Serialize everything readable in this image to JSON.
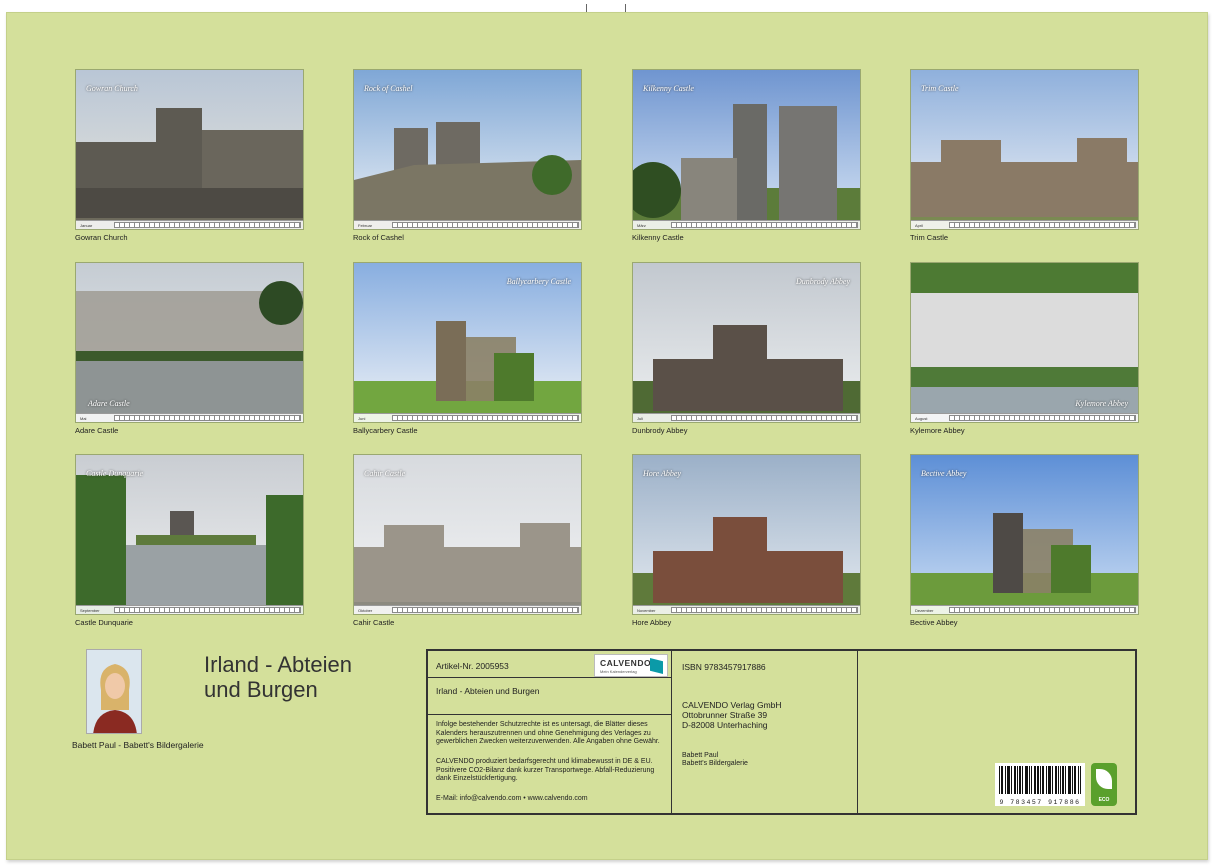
{
  "calendar": {
    "title": "Irland - Abteien und Burgen",
    "title_line1": "Irland - Abteien",
    "title_line2": "und Burgen",
    "author": "Babett Paul - Babett's Bildergalerie"
  },
  "months": [
    {
      "photo_title": "Gowran Church",
      "strip_label": "Januar",
      "caption": "Gowran Church"
    },
    {
      "photo_title": "Rock of Cashel",
      "strip_label": "Februar",
      "caption": "Rock of Cashel"
    },
    {
      "photo_title": "Kilkenny Castle",
      "strip_label": "März",
      "caption": "Kilkenny Castle"
    },
    {
      "photo_title": "Trim Castle",
      "strip_label": "April",
      "caption": "Trim Castle"
    },
    {
      "photo_title": "Adare Castle",
      "strip_label": "Mai",
      "caption": "Adare Castle"
    },
    {
      "photo_title": "Ballycarbery Castle",
      "strip_label": "Juni",
      "caption": "Ballycarbery Castle"
    },
    {
      "photo_title": "Dunbrody Abbey",
      "strip_label": "Juli",
      "caption": "Dunbrody Abbey"
    },
    {
      "photo_title": "Kylemore Abbey",
      "strip_label": "August",
      "caption": "Kylemore Abbey"
    },
    {
      "photo_title": "Castle Dunquarie",
      "strip_label": "September",
      "caption": "Castle Dunquarie"
    },
    {
      "photo_title": "Cahir Castle",
      "strip_label": "Oktober",
      "caption": "Cahir Castle"
    },
    {
      "photo_title": "Hore Abbey",
      "strip_label": "November",
      "caption": "Hore Abbey"
    },
    {
      "photo_title": "Bective Abbey",
      "strip_label": "Dezember",
      "caption": "Bective Abbey"
    }
  ],
  "info": {
    "article_no": "Artikel-Nr. 2005953",
    "product_title": "Irland - Abteien und Burgen",
    "logo_word": "CALVENDO",
    "logo_sub": "Mein Kalenderverlag",
    "legal": "Infolge bestehender Schutzrechte ist es untersagt, die Blätter dieses Kalenders herauszutrennen und ohne Genehmigung des Verlages zu gewerblichen Zwecken weiterzuverwenden. Alle Angaben ohne Gewähr.",
    "climate": "CALVENDO produziert bedarfsgerecht und klimabewusst in DE & EU. Positivere CO2-Bilanz dank kurzer Transportwege. Abfall-Reduzierung dank Einzelstückfertigung.",
    "contact": "E-Mail: info@calvendo.com • www.calvendo.com",
    "isbn": "ISBN 9783457917886",
    "publisher_name": "CALVENDO Verlag GmbH",
    "publisher_street": "Ottobrunner Straße 39",
    "publisher_city": "D-82008 Unterhaching",
    "author_name": "Babett Paul",
    "author_gallery": "Babett's Bildergalerie",
    "barcode_digits": "9 783457 917886",
    "eco_label": "ECO"
  },
  "colors": {
    "page_background": "#d4e09b",
    "logo_accent": "#0b9aa8",
    "eco_green": "#5aa02c"
  }
}
